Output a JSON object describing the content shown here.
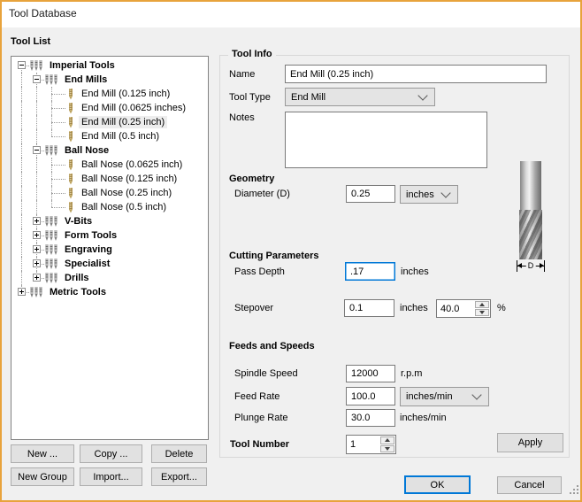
{
  "window": {
    "title": "Tool Database"
  },
  "colors": {
    "window_border": "#E8A33C",
    "focus": "#0078D7",
    "client_bg": "#F0F0F0",
    "combo_bg": "#E4E4E4",
    "button_bg": "#E1E1E1"
  },
  "icons": {
    "tree_group": "drill-bits-group-icon",
    "tree_tool": "drill-bit-icon",
    "expander_expanded": "minus-box-icon",
    "expander_collapsed": "plus-box-icon",
    "combo": "chevron-down-icon",
    "spin_up": "arrow-up-icon",
    "spin_down": "arrow-down-icon",
    "grip": "resize-grip-icon"
  },
  "tool_list": {
    "label": "Tool List",
    "tree": [
      {
        "label": "Imperial Tools",
        "level": 0,
        "kind": "group",
        "expander": "expanded"
      },
      {
        "label": "End Mills",
        "level": 1,
        "kind": "group",
        "expander": "expanded"
      },
      {
        "label": "End Mill (0.125 inch)",
        "level": 2,
        "kind": "tool"
      },
      {
        "label": "End Mill (0.0625 inches)",
        "level": 2,
        "kind": "tool"
      },
      {
        "label": "End Mill (0.25 inch)",
        "level": 2,
        "kind": "tool",
        "selected": true
      },
      {
        "label": "End Mill (0.5 inch)",
        "level": 2,
        "kind": "tool"
      },
      {
        "label": "Ball Nose",
        "level": 1,
        "kind": "group",
        "expander": "expanded"
      },
      {
        "label": "Ball Nose (0.0625 inch)",
        "level": 2,
        "kind": "tool"
      },
      {
        "label": "Ball Nose (0.125 inch)",
        "level": 2,
        "kind": "tool"
      },
      {
        "label": "Ball Nose (0.25 inch)",
        "level": 2,
        "kind": "tool"
      },
      {
        "label": "Ball Nose (0.5 inch)",
        "level": 2,
        "kind": "tool"
      },
      {
        "label": "V-Bits",
        "level": 1,
        "kind": "group",
        "expander": "collapsed"
      },
      {
        "label": "Form Tools",
        "level": 1,
        "kind": "group",
        "expander": "collapsed"
      },
      {
        "label": "Engraving",
        "level": 1,
        "kind": "group",
        "expander": "collapsed"
      },
      {
        "label": "Specialist",
        "level": 1,
        "kind": "group",
        "expander": "collapsed"
      },
      {
        "label": "Drills",
        "level": 1,
        "kind": "group",
        "expander": "collapsed"
      },
      {
        "label": "Metric Tools",
        "level": 0,
        "kind": "group",
        "expander": "collapsed"
      }
    ],
    "buttons": {
      "new": "New ...",
      "copy": "Copy ...",
      "delete": "Delete",
      "new_group": "New Group",
      "import": "Import...",
      "export": "Export..."
    }
  },
  "tool_info": {
    "legend": "Tool Info",
    "name": {
      "label": "Name",
      "value": "End Mill (0.25 inch)"
    },
    "tool_type": {
      "label": "Tool Type",
      "value": "End Mill"
    },
    "notes": {
      "label": "Notes",
      "value": ""
    },
    "geometry": {
      "heading": "Geometry",
      "diameter": {
        "label": "Diameter (D)",
        "value": "0.25",
        "units": "inches"
      },
      "diagram_label": "D"
    },
    "cutting": {
      "heading": "Cutting Parameters",
      "pass_depth": {
        "label": "Pass Depth",
        "value": ".17",
        "units": "inches"
      },
      "stepover": {
        "label": "Stepover",
        "value": "0.1",
        "units": "inches",
        "percent": "40.0",
        "percent_units": "%"
      }
    },
    "feeds": {
      "heading": "Feeds and Speeds",
      "spindle_speed": {
        "label": "Spindle Speed",
        "value": "12000",
        "units": "r.p.m"
      },
      "feed_rate": {
        "label": "Feed Rate",
        "value": "100.0",
        "units": "inches/min"
      },
      "plunge_rate": {
        "label": "Plunge Rate",
        "value": "30.0",
        "units": "inches/min"
      }
    },
    "tool_number": {
      "label": "Tool Number",
      "value": "1"
    },
    "apply": "Apply"
  },
  "footer": {
    "ok": "OK",
    "cancel": "Cancel"
  }
}
